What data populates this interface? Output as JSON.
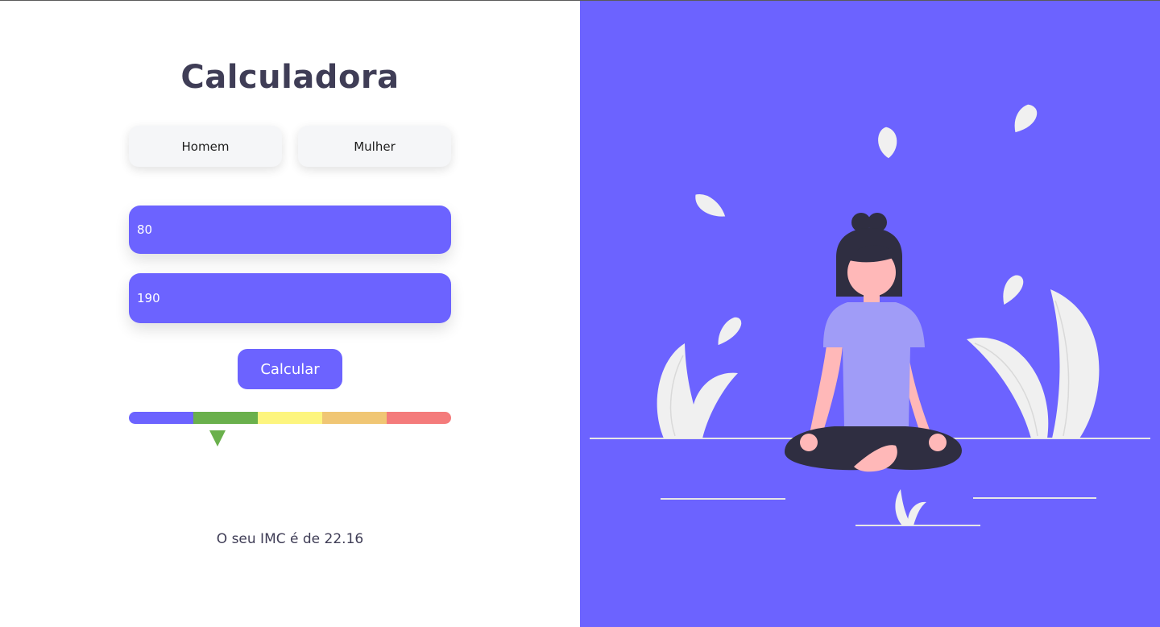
{
  "title": "Calculadora",
  "gender": {
    "male_label": "Homem",
    "female_label": "Mulher"
  },
  "inputs": {
    "weight_value": "80",
    "height_value": "190"
  },
  "calculate_label": "Calcular",
  "bmi_scale": {
    "colors": [
      "#6c63ff",
      "#6ab04c",
      "#fdf57e",
      "#f0c674",
      "#f47b7b"
    ],
    "indicator_segment": 1,
    "indicator_color": "#6ab04c"
  },
  "result_text": "O seu IMC é de 22.16",
  "colors": {
    "accent": "#6c63ff",
    "text_dark": "#3f3d56",
    "button_bg": "#f5f6f8"
  },
  "illustration": "meditation-illustration"
}
